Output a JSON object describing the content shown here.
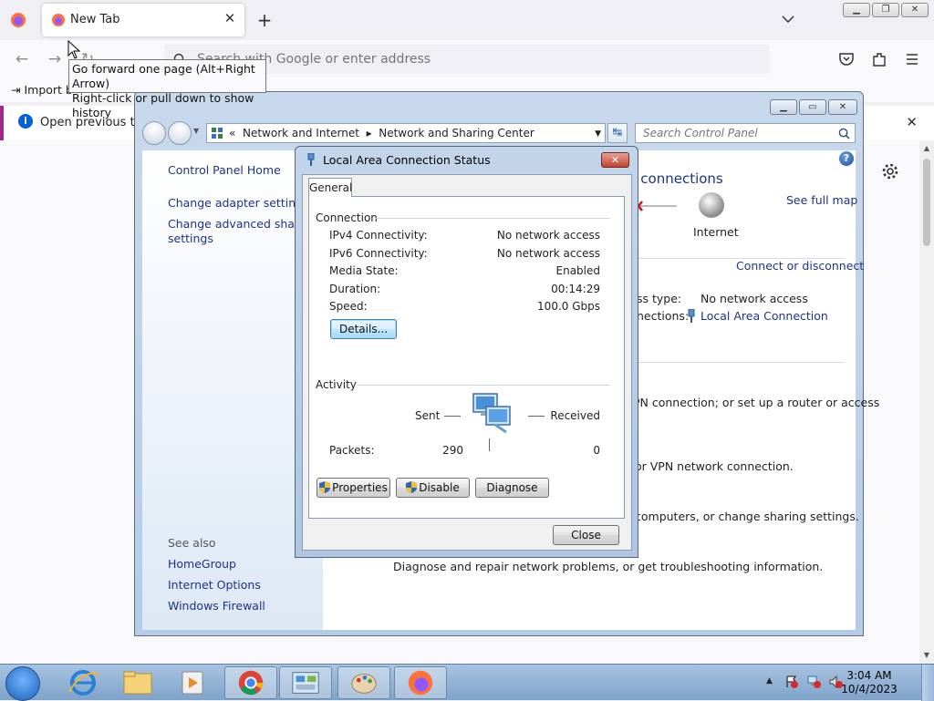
{
  "browser": {
    "tab_title": "New Tab",
    "url_placeholder": "Search with Google or enter address",
    "import_label": "Import b",
    "tooltip_line1": "Go forward one page (Alt+Right Arrow)",
    "tooltip_line2": "Right-click or pull down to show history",
    "notification_text": "Open previous tabs"
  },
  "control_panel": {
    "breadcrumb": [
      "Network and Internet",
      "Network and Sharing Center"
    ],
    "breadcrumb_prefix": "«",
    "search_placeholder": "Search Control Panel",
    "sidebar": {
      "home": "Control Panel Home",
      "adapter": "Change adapter settings",
      "advanced_1": "Change advanced sharing",
      "advanced_2": "settings",
      "see_also": "See also",
      "homegroup": "HomeGroup",
      "internet_options": "Internet Options",
      "windows_firewall": "Windows Firewall"
    },
    "main": {
      "heading_partial": "p connections",
      "see_full_map": "See full map",
      "internet_label": "Internet",
      "connect_or_disconnect": "Connect or disconnect",
      "access_type_label": "ss type:",
      "access_type_value": "No network access",
      "connections_label": "nections:",
      "connection_link": "Local Area Connection",
      "setup_text": "PN connection; or set up a router or access",
      "vpn_text": "or VPN network connection.",
      "sharing_text": "computers, or change sharing settings.",
      "diagnose_text": "Diagnose and repair network problems, or get troubleshooting information."
    }
  },
  "dialog": {
    "title": "Local Area Connection Status",
    "tab": "General",
    "connection_group": "Connection",
    "rows": [
      {
        "label": "IPv4 Connectivity:",
        "value": "No network access"
      },
      {
        "label": "IPv6 Connectivity:",
        "value": "No network access"
      },
      {
        "label": "Media State:",
        "value": "Enabled"
      },
      {
        "label": "Duration:",
        "value": "00:14:29"
      },
      {
        "label": "Speed:",
        "value": "100.0 Gbps"
      }
    ],
    "details_button": "Details...",
    "activity_group": "Activity",
    "sent_label": "Sent",
    "received_label": "Received",
    "packets_label": "Packets:",
    "packets_sent": "290",
    "packets_received": "0",
    "properties_button": "Properties",
    "disable_button": "Disable",
    "diagnose_button": "Diagnose",
    "close_button": "Close"
  },
  "taskbar": {
    "time": "3:04 AM",
    "date": "10/4/2023"
  },
  "colors": {
    "link": "#1e3287",
    "firefox_accent": "#0060df",
    "notification_bar": "#a02a8c"
  }
}
